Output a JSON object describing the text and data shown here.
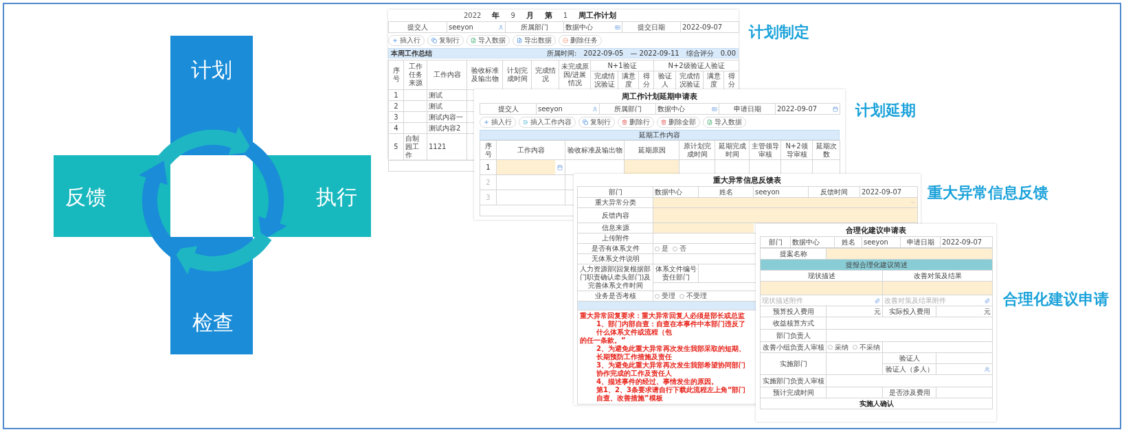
{
  "diagram": {
    "labels": [
      "计划",
      "反馈",
      "执行",
      "检查"
    ]
  },
  "section_labels": [
    "计划制定",
    "计划延期",
    "重大异常信息反馈",
    "合理化建议申请"
  ],
  "weekly_plan": {
    "year": "2022",
    "year_label": "年",
    "month": "9",
    "month_label": "月",
    "week_label": "第",
    "week": "1",
    "title": "周工作计划",
    "info": [
      "提交人",
      "seeyon",
      "所属部门",
      "数据中心",
      "提交日期",
      "2022-09-07"
    ],
    "buttons": [
      {
        "label": "插入行",
        "kind": "add"
      },
      {
        "label": "复制行",
        "kind": "copy"
      },
      {
        "label": "导入数据",
        "kind": "import"
      },
      {
        "label": "导出数据",
        "kind": "export"
      },
      {
        "label": "删除任务",
        "kind": "remove"
      }
    ],
    "section": {
      "title": "本周工作总结",
      "period_label": "所属时间:",
      "start": "2022-09-05",
      "end": "— 2022-09-11",
      "score_label": "综合评分",
      "score": "0.00"
    },
    "columns": [
      "序号",
      "工作任务来源",
      "工作内容",
      "验收标准及输出物",
      "计划完成时间",
      "完成情况",
      "未完成原因/进展情况"
    ],
    "group_n1": {
      "title": "N+1验证",
      "columns": [
        "完成情况验证",
        "满意度",
        "得分"
      ]
    },
    "group_n2": {
      "title": "N+2级验证人验证",
      "columns": [
        "验证人",
        "完成情况验证",
        "满意度",
        "得分"
      ]
    },
    "rows": [
      {
        "no": "1",
        "content": "测试"
      },
      {
        "no": "2",
        "content": "测试"
      },
      {
        "no": "3",
        "content": "测试内容一"
      },
      {
        "no": "4",
        "content": "测试内容2"
      },
      {
        "no": "5",
        "source": "自制园工作",
        "content": "1121"
      }
    ]
  },
  "delay_request": {
    "title": "周工作计划延期申请表",
    "info": [
      "提交人",
      "seeyon",
      "所属部门",
      "数据中心",
      "申请日期",
      "2022-09-07"
    ],
    "buttons": [
      {
        "label": "插入行",
        "kind": "add"
      },
      {
        "label": "插入工作内容",
        "kind": "insert"
      },
      {
        "label": "复制行",
        "kind": "copy"
      },
      {
        "label": "删除行",
        "kind": "delete"
      },
      {
        "label": "删除全部",
        "kind": "delete"
      },
      {
        "label": "导入数据",
        "kind": "import"
      }
    ],
    "section": "延期工作内容",
    "columns": [
      "序号",
      "工作内容",
      "验收标准及输出物",
      "延期原因",
      "原计划完成时间",
      "延期完成时间",
      "主管领导审核",
      "N+2领导审核",
      "延期次数"
    ],
    "rows": [
      {
        "no": "1",
        "disabled": false
      },
      {
        "no": "2",
        "disabled": true
      },
      {
        "no": "3",
        "disabled": true
      }
    ]
  },
  "major_exception_feedback": {
    "title": "重大异常信息反馈表",
    "info": [
      "部门",
      "数据中心",
      "姓名",
      "seeyon",
      "反馈时间",
      "2022-09-07"
    ],
    "fields": [
      {
        "label": "重大异常分类",
        "kind": "select"
      },
      {
        "label": "反馈内容",
        "kind": "textarea"
      },
      {
        "label": "信息来源",
        "kind": "input"
      },
      {
        "label": "上传附件",
        "kind": "plain"
      },
      {
        "label": "是否有体系文件",
        "kind": "radio",
        "options": [
          {
            "label": "是",
            "selected": false
          },
          {
            "label": "否",
            "selected": false
          }
        ]
      },
      {
        "label": "无体系文件说明",
        "kind": "plain"
      },
      {
        "label": "人力资源部(回复根据部门职责确认牵头部门)及完善体系文件时间",
        "kind": "split",
        "sublabel": "体系文件编号责任部门"
      },
      {
        "label": "业务是否考核",
        "kind": "radio",
        "options": [
          {
            "label": "受理",
            "selected": false
          },
          {
            "label": "不受理",
            "selected": false
          }
        ]
      }
    ],
    "notes": [
      {
        "text": "重大异常回复要求：重大异常回复人必须是部长或总监",
        "kind": "heading"
      },
      {
        "text": "1、部门内部自查：自查在本事件中本部门违反了什么体系文件或流程（包",
        "kind": "item"
      },
      {
        "text": "的任一条款。”",
        "kind": "continuation"
      },
      {
        "text": "2、为避免此重大异常再次发生我部采取的短期、长期预防工作措施及责任",
        "kind": "item"
      },
      {
        "text": "3、为避免此重大异常再次发生我部希望协同部门协作完成的工作及责任人",
        "kind": "item"
      },
      {
        "text": "4、描述事件的经过、事情发生的原因。",
        "kind": "item"
      },
      {
        "text": "第1、2、3条要求请自行下载此流程左上角“部门自查、改善措施”模板",
        "kind": "item"
      }
    ]
  },
  "suggestion_request": {
    "title": "合理化建议申请表",
    "info": [
      "部门",
      "数据中心",
      "姓名",
      "seeyon",
      "申请日期",
      "2022-09-07"
    ],
    "proposal_label": "提案名称",
    "summary_bar": "提报合理化建议简述",
    "description_headers": [
      "现状描述",
      "改善对策及结果"
    ],
    "attachments": [
      {
        "placeholder": "现状描述附件"
      },
      {
        "placeholder": "改善对策及结果附件"
      }
    ],
    "budget_label": "预算投入费用",
    "budget_unit": "元",
    "actual_label": "实际投入费用",
    "actual_unit": "元",
    "benefit_label": "收益核算方式",
    "manager_label": "部门负责人",
    "review": {
      "label": "改善小组负责人审核",
      "options": [
        {
          "label": "采纳",
          "selected": false
        },
        {
          "label": "不采纳",
          "selected": false
        }
      ]
    },
    "implement_label": "实施部门",
    "verifier_label": "验证人",
    "verifiers_label": "验证人（多人）",
    "implement_review_label": "实施部门负责人审核",
    "due_label": "预计完成时间",
    "cost_label": "是否涉及费用",
    "confirm_title": "实施人确认"
  }
}
